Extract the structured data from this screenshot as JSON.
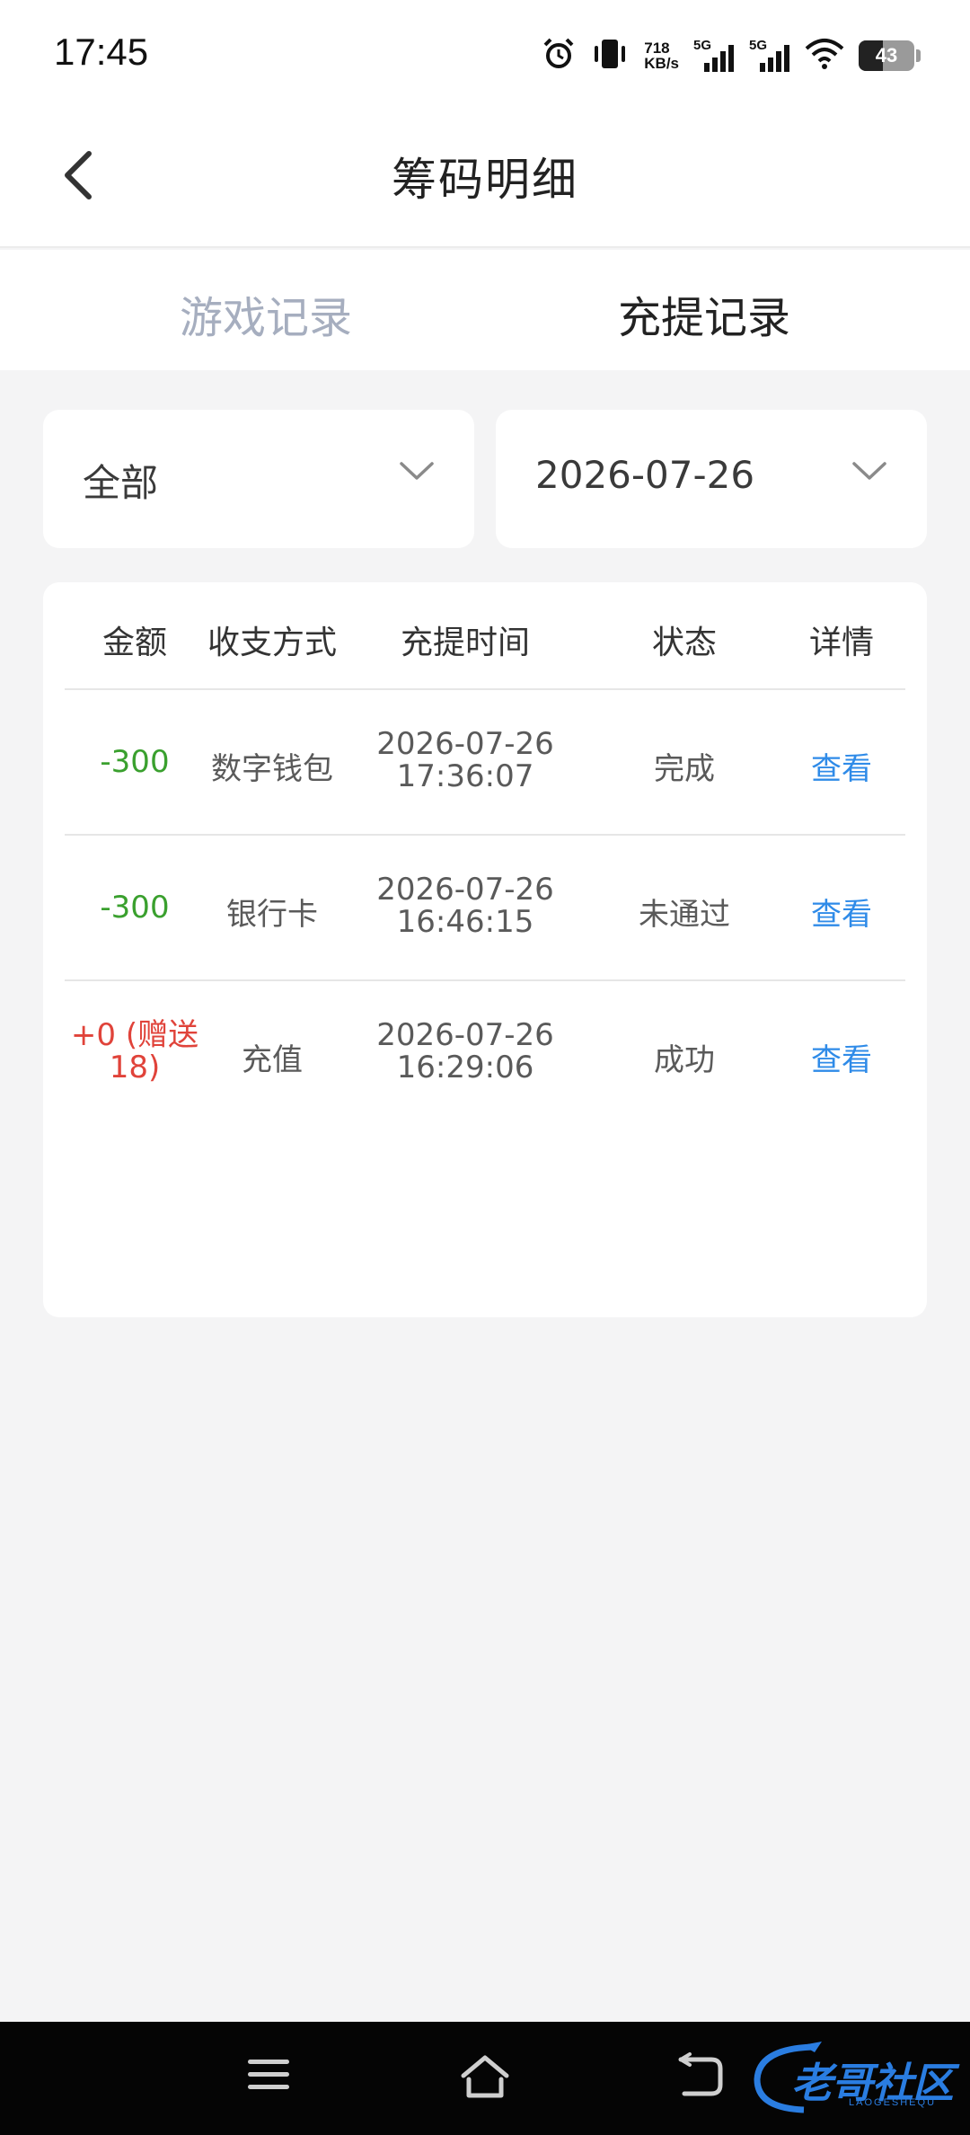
{
  "status_bar": {
    "time": "17:45",
    "net_speed_value": "718",
    "net_speed_unit": "KB/s",
    "signal1_label": "5G",
    "signal2_label": "5G",
    "battery_level": "43",
    "battery_fraction": 0.43
  },
  "header": {
    "title": "筹码明细"
  },
  "tabs": [
    {
      "label": "游戏记录",
      "active": false
    },
    {
      "label": "充提记录",
      "active": true
    }
  ],
  "filters": {
    "type_value": "全部",
    "date_value": "2026-07-26"
  },
  "table": {
    "columns": [
      "金额",
      "收支方式",
      "充提时间",
      "状态",
      "详情"
    ],
    "rows": [
      {
        "amount": "-300",
        "method": "数字钱包",
        "date": "2026-07-26",
        "time": "17:36:07",
        "status": "完成",
        "detail": "查看"
      },
      {
        "amount": "-300",
        "method": "银行卡",
        "date": "2026-07-26",
        "time": "16:46:15",
        "status": "未通过",
        "detail": "查看"
      },
      {
        "amount_line1": "+0 (赠送",
        "amount_line2": "18)",
        "method": "充值",
        "date": "2026-07-26",
        "time": "16:29:06",
        "status": "成功",
        "detail": "查看"
      }
    ]
  },
  "colors": {
    "negative_amount": "#3aa02e",
    "positive_amount": "#e0433a",
    "link": "#2f8be8",
    "inactive_tab": "#a6aebf"
  },
  "watermark": {
    "text": "老哥社区",
    "sub": "LAOGESHEQU"
  },
  "icons": {
    "back": "chevron-left-icon",
    "dropdown": "chevron-down-icon",
    "nav_menu": "menu-icon",
    "nav_home": "home-icon",
    "nav_back": "back-icon"
  }
}
